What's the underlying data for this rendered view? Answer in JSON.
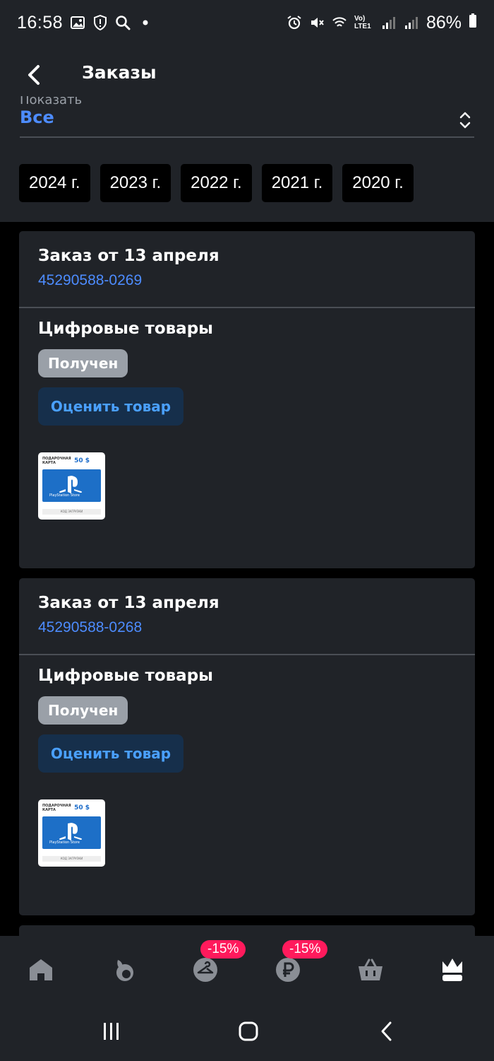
{
  "status_bar": {
    "time": "16:58",
    "battery": "86%",
    "network": "Vo) LTE1"
  },
  "header": {
    "title": "Заказы"
  },
  "filter": {
    "label": "Показать",
    "value": "Все"
  },
  "years": [
    "2024 г.",
    "2023 г.",
    "2022 г.",
    "2021 г.",
    "2020 г."
  ],
  "orders": [
    {
      "title": "Заказ от 13 апреля",
      "number": "45290588-0269",
      "section": "Цифровые товары",
      "status": "Получен",
      "rate_label": "Оценить товар",
      "thumb": {
        "top": "ПОДАРОЧНАЯ КАРТА",
        "price": "50 $",
        "store": "PlayStation Store",
        "bottom": "КОД ЗАГРУЗКИ"
      }
    },
    {
      "title": "Заказ от 13 апреля",
      "number": "45290588-0268",
      "section": "Цифровые товары",
      "status": "Получен",
      "rate_label": "Оценить товар",
      "thumb": {
        "top": "ПОДАРОЧНАЯ КАРТА",
        "price": "50 $",
        "store": "PlayStation Store",
        "bottom": "КОД ЗАГРУЗКИ"
      }
    }
  ],
  "bottom_nav": {
    "badge_1": "-15%",
    "badge_2": "-15%"
  },
  "colors": {
    "background": "#202328",
    "accent": "#4d8cff",
    "badge": "#ff1a5c"
  }
}
